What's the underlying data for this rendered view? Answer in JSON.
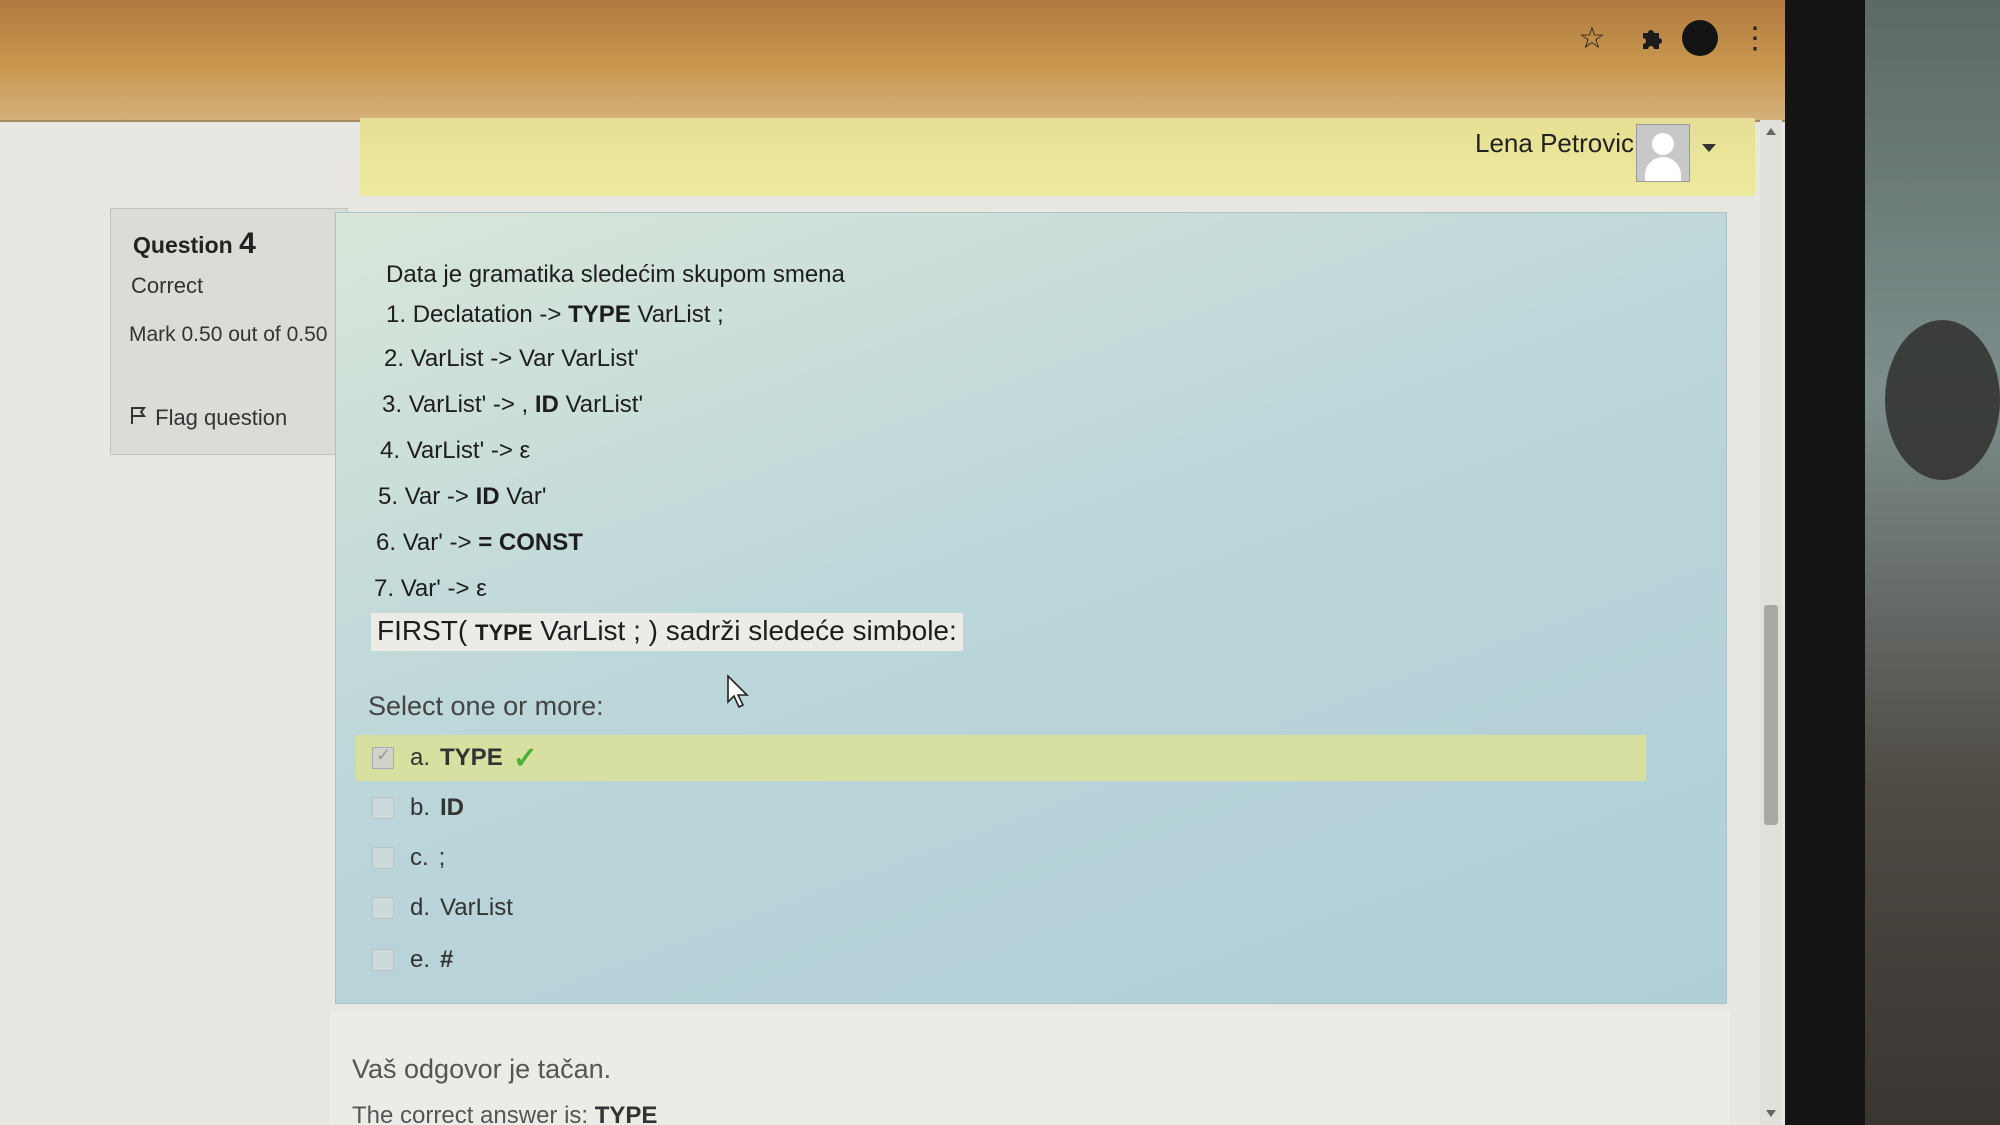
{
  "browser": {
    "bookmark_icon": "star-icon",
    "extensions_icon": "puzzle-icon",
    "menu_icon": "kebab-icon"
  },
  "user": {
    "name": "Lena Petrovic"
  },
  "info": {
    "question_word": "Question",
    "question_number": "4",
    "state": "Correct",
    "mark": "Mark 0.50 out of 0.50",
    "flag": "Flag question"
  },
  "question": {
    "intro": "Data je gramatika sledećim skupom smena",
    "rules": [
      {
        "num": "1.",
        "lhs": "Declatation ->",
        "bold": "TYPE",
        "rest": "VarList ;"
      },
      {
        "num": "2.",
        "lhs": "VarList -> Var VarList'",
        "bold": "",
        "rest": ""
      },
      {
        "num": "3.",
        "lhs": "VarList' -> ,",
        "bold": "ID",
        "rest": "VarList'"
      },
      {
        "num": "4.",
        "lhs": "VarList' -> ε",
        "bold": "",
        "rest": ""
      },
      {
        "num": "5.",
        "lhs": "Var ->",
        "bold": "ID",
        "rest": "Var'"
      },
      {
        "num": "6.",
        "lhs": "Var' ->",
        "bold": "= CONST",
        "rest": ""
      },
      {
        "num": "7.",
        "lhs": "Var' -> ε",
        "bold": "",
        "rest": ""
      }
    ],
    "first_prefix": "FIRST(",
    "first_bold": "TYPE",
    "first_suffix": "VarList ; ) sadrži sledeće simbole:",
    "prompt": "Select one or more:",
    "options": [
      {
        "letter": "a.",
        "value": "TYPE",
        "checked": true,
        "correct": true
      },
      {
        "letter": "b.",
        "value": "ID",
        "checked": false,
        "correct": false
      },
      {
        "letter": "c.",
        "value": ";",
        "checked": false,
        "correct": false
      },
      {
        "letter": "d.",
        "value": "VarList",
        "checked": false,
        "correct": false
      },
      {
        "letter": "e.",
        "value": "#",
        "checked": false,
        "correct": false
      }
    ]
  },
  "feedback": {
    "message": "Vaš odgovor je tačan.",
    "correct_prefix": "The correct answer is:",
    "correct_value": "TYPE"
  },
  "colors": {
    "panel": "#bcd6da",
    "correct_row": "#d7e0a0",
    "tick": "#4caf3a"
  }
}
